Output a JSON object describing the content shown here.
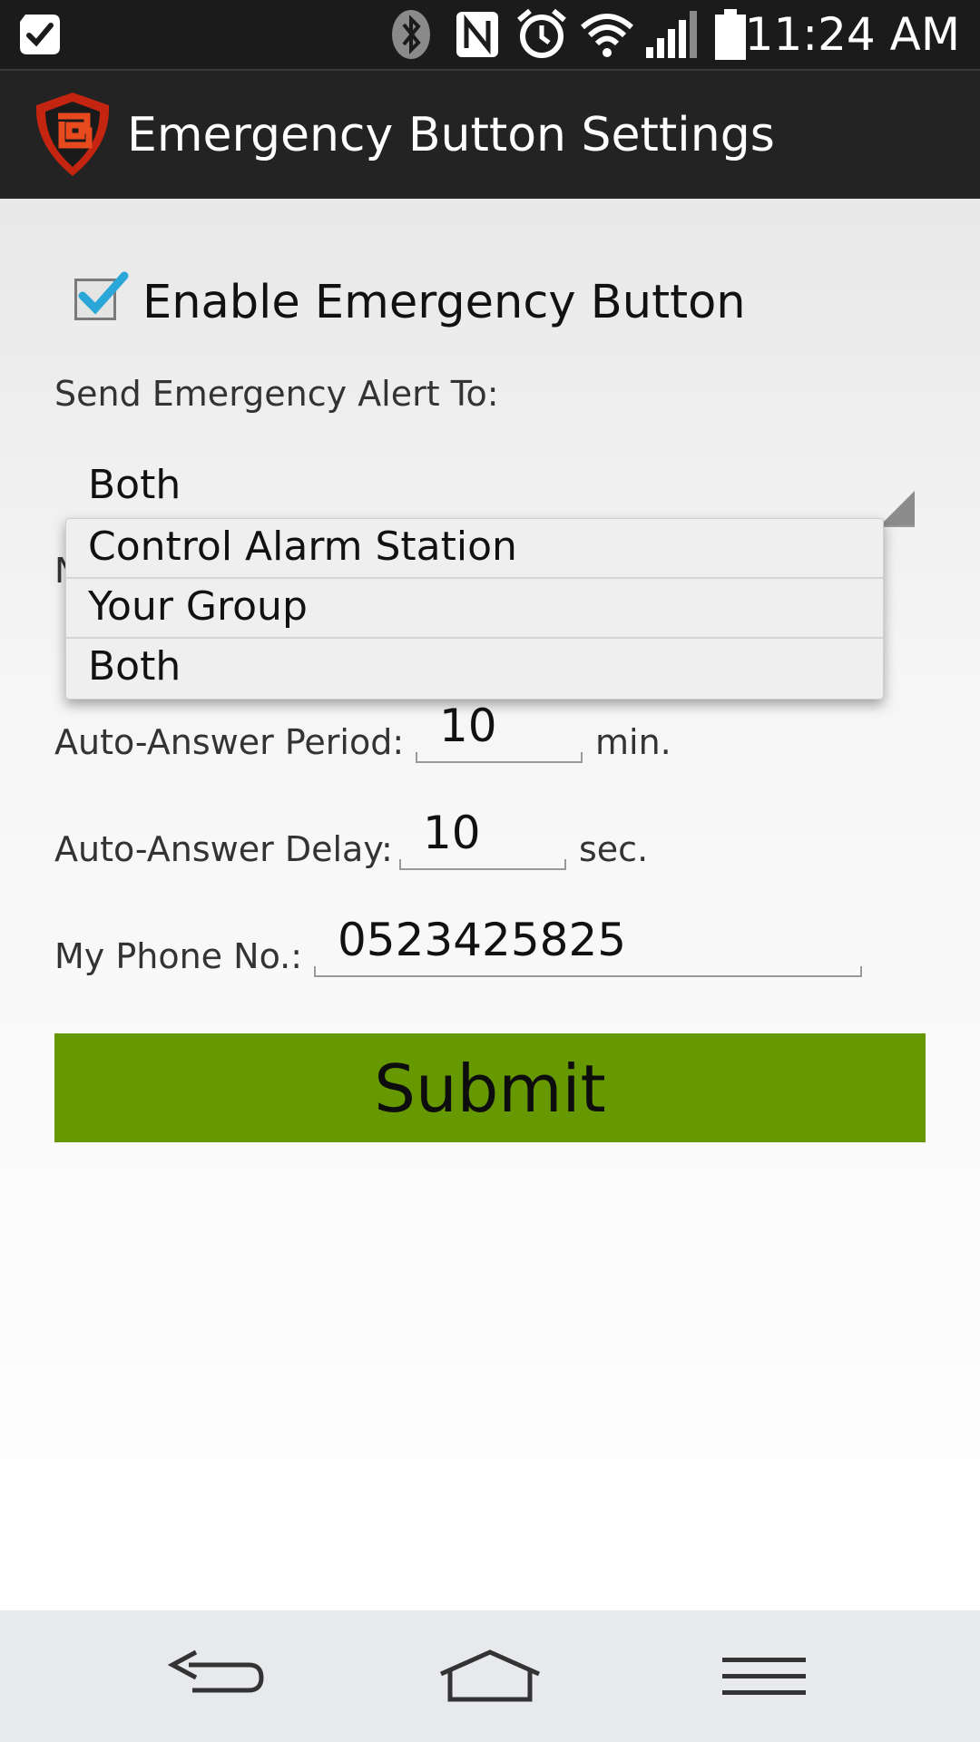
{
  "status_bar": {
    "time": "11:24 AM",
    "icons": [
      "task-check-icon",
      "bluetooth-icon",
      "nfc-icon",
      "alarm-icon",
      "wifi-icon",
      "signal-icon",
      "battery-icon"
    ]
  },
  "action_bar": {
    "title": "Emergency Button Settings",
    "logo_icon": "shield-logo-icon"
  },
  "form": {
    "enable_label": "Enable Emergency Button",
    "enable_checked": true,
    "send_alert_label": "Send Emergency Alert To:",
    "send_alert_value": "Both",
    "dropdown_options": [
      "Control Alarm Station",
      "Your Group",
      "Both"
    ],
    "occluded_label_fragment": "N",
    "auto_answer_period_label": "Auto-Answer Period:",
    "auto_answer_period_value": "10",
    "auto_answer_period_unit": "min.",
    "auto_answer_delay_label": "Auto-Answer Delay:",
    "auto_answer_delay_value": "10",
    "auto_answer_delay_unit": "sec.",
    "phone_label": "My Phone No.:",
    "phone_value": "0523425825",
    "submit_label": "Submit"
  },
  "colors": {
    "accent_checkmark": "#2aa7d8",
    "submit_background": "#669900",
    "status_bar": "#1b1b1b",
    "action_bar": "#232323",
    "nav_bar": "#e7e9ec"
  },
  "nav_bar": {
    "buttons": [
      "back-icon",
      "home-icon",
      "menu-icon"
    ]
  }
}
